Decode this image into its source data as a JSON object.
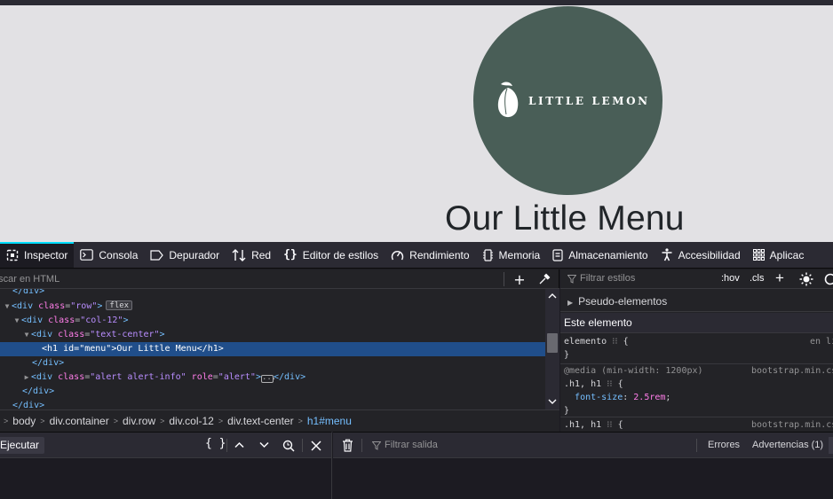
{
  "page": {
    "logo_text": "LITTLE LEMON",
    "heading": "Our Little Menu"
  },
  "devtools": {
    "tabs": [
      {
        "label": "Inspector",
        "icon": "inspector-icon",
        "active": true
      },
      {
        "label": "Consola",
        "icon": "console-icon"
      },
      {
        "label": "Depurador",
        "icon": "debugger-icon"
      },
      {
        "label": "Red",
        "icon": "network-icon"
      },
      {
        "label": "Editor de estilos",
        "icon": "style-editor-icon"
      },
      {
        "label": "Rendimiento",
        "icon": "performance-icon"
      },
      {
        "label": "Memoria",
        "icon": "memory-icon"
      },
      {
        "label": "Almacenamiento",
        "icon": "storage-icon"
      },
      {
        "label": "Accesibilidad",
        "icon": "accessibility-icon"
      },
      {
        "label": "Aplicac",
        "icon": "application-icon"
      }
    ],
    "search_placeholder": "uscar en HTML",
    "markup": {
      "l0": "</div>",
      "l1_tag": "div",
      "l1_attr": "class",
      "l1_val": "\"row\"",
      "l1_badge": "flex",
      "l2_tag": "div",
      "l2_attr": "class",
      "l2_val": "\"col-12\"",
      "l3_tag": "div",
      "l3_attr": "class",
      "l3_val": "\"text-center\"",
      "l4_tag": "h1",
      "l4_attr": "id",
      "l4_val": "\"menu\"",
      "l4_text": "Our Little Menu",
      "l4_close": "</h1>",
      "l5": "</div>",
      "l6_tag": "div",
      "l6_attr1": "class",
      "l6_val1": "\"alert alert-info\"",
      "l6_attr2": "role",
      "l6_val2": "\"alert\"",
      "l6_close": "</div>",
      "l7": "</div>",
      "l8": "</div>"
    },
    "breadcrumbs": [
      "body",
      "div.container",
      "div.row",
      "div.col-12",
      "div.text-center",
      "h1#menu"
    ],
    "rules": {
      "filter_placeholder": "Filtrar estilos",
      "hov": ":hov",
      "cls": ".cls",
      "pseudo": "Pseudo-elementos",
      "this_element": "Este elemento",
      "element_selector": "elemento",
      "element_source": "en lí",
      "media": "@media (min-width: 1200px)",
      "media_source": "bootstrap.min.cs",
      "rule1_selector": ".h1, h1",
      "rule1_prop": "font-size",
      "rule1_value": "2.5rem",
      "rule2_selector": ".h1, h1",
      "rule2_source": "bootstrap.min.cs"
    },
    "console": {
      "run": "Ejecutar",
      "filter_output": "Filtrar salida",
      "errors": "Errores",
      "warnings": "Advertencias (1)"
    }
  }
}
